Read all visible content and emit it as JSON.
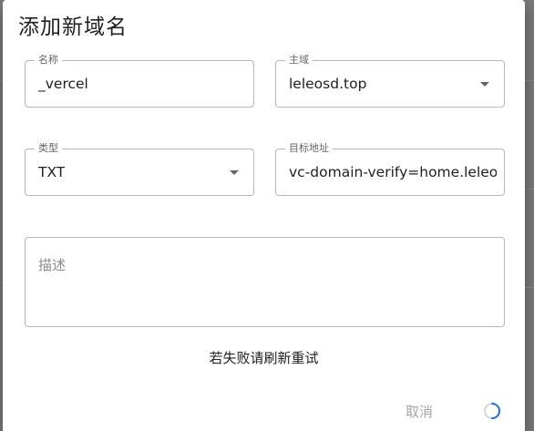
{
  "dialog": {
    "title": "添加新域名",
    "fields": {
      "name": {
        "label": "名称",
        "value": "_vercel"
      },
      "domain": {
        "label": "主域",
        "value": "leleosd.top"
      },
      "type": {
        "label": "类型",
        "value": "TXT"
      },
      "target": {
        "label": "目标地址",
        "value": "vc-domain-verify=home.leleo"
      },
      "description": {
        "placeholder": "描述"
      }
    },
    "message": "若失败请刷新重试",
    "cancel_label": "取消",
    "loading_icon": "spinner-icon"
  },
  "colors": {
    "backdrop": "#7a7a7a",
    "spinner": "#1a73e8"
  }
}
